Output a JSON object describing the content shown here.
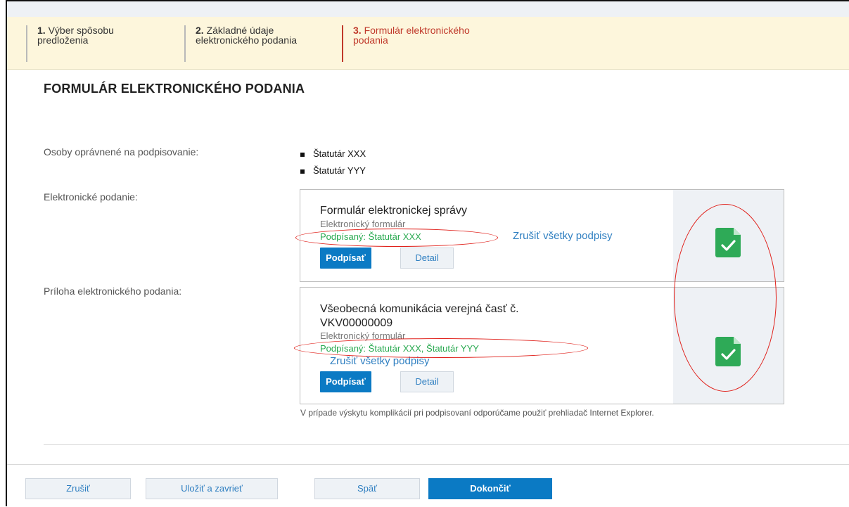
{
  "steps": [
    {
      "number": "1.",
      "label": "Výber spôsobu predloženia"
    },
    {
      "number": "2.",
      "label": "Základné údaje elektronického podania"
    },
    {
      "number": "3.",
      "label": "Formulár elektronického podania"
    }
  ],
  "page_title": "FORMULÁR ELEKTRONICKÉHO PODANIA",
  "labels": {
    "signers": "Osoby oprávnené na podpisovanie:",
    "submission": "Elektronické podanie:",
    "attachment": "Príloha elektronického podania:"
  },
  "signers": [
    "Štatutár XXX",
    "Štatutár YYY"
  ],
  "submission_card": {
    "name": "Formulár elektronickej správy",
    "type": "Elektronický formulár",
    "signed": "Podpísaný:  Štatutár XXX",
    "cancel_signatures": "Zrušiť všetky podpisy",
    "sign_button": "Podpísať",
    "detail_button": "Detail",
    "icon": "document-check-icon"
  },
  "attachment_card": {
    "name_line1": "Všeobecná komunikácia verejná časť č.",
    "name_line2": "VKV00000009",
    "type": "Elektronický formulár",
    "signed": "Podpísaný:  Štatutár XXX, Štatutár YYY",
    "cancel_signatures": "Zrušiť všetky podpisy",
    "sign_button": "Podpísať",
    "detail_button": "Detail",
    "icon": "document-check-icon"
  },
  "note": "V prípade výskytu komplikácií pri podpisovaní odporúčame použiť prehliadač Internet Explorer.",
  "footer": {
    "cancel": "Zrušiť",
    "save_close": "Uložiť a zavrieť",
    "back": "Späť",
    "finish": "Dokončiť"
  },
  "colors": {
    "accent": "#0b7ac4",
    "signed_green": "#27a94f",
    "active_step": "#c0392b",
    "annotation_red": "#e0201a"
  }
}
